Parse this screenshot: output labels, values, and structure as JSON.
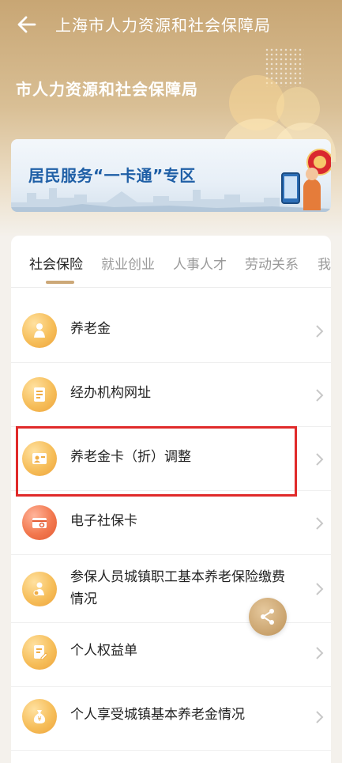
{
  "topbar": {
    "title": "上海市人力资源和社会保障局",
    "back_icon": "arrow-left-icon"
  },
  "hero": {
    "title": "市人力资源和社会保障局"
  },
  "banner": {
    "title": "居民服务“一卡通”专区"
  },
  "tabs": [
    {
      "label": "社会保险",
      "active": true
    },
    {
      "label": "就业创业",
      "active": false
    },
    {
      "label": "人事人才",
      "active": false
    },
    {
      "label": "劳动关系",
      "active": false
    },
    {
      "label": "我",
      "active": false
    }
  ],
  "items": [
    {
      "label": "养老金",
      "icon": "elderly-person-icon",
      "color": "#f6be5a"
    },
    {
      "label": "经办机构网址",
      "icon": "document-list-icon",
      "color": "#f6be5a"
    },
    {
      "label": "养老金卡（折）调整",
      "icon": "id-card-icon",
      "color": "#f6be5a",
      "highlighted": true
    },
    {
      "label": "电子社保卡",
      "icon": "social-security-card-icon",
      "color": "#f2784f"
    },
    {
      "label_line1": "参保人员城镇职工基本养老保险缴费",
      "label_line2": "情况",
      "icon": "person-shield-icon",
      "color": "#f6be5a"
    },
    {
      "label": "个人权益单",
      "icon": "edit-document-icon",
      "color": "#f6be5a"
    },
    {
      "label": "个人享受城镇基本养老金情况",
      "icon": "money-bag-icon",
      "color": "#f6be5a"
    }
  ],
  "share_button": {
    "icon": "share-icon"
  },
  "colors": {
    "accent": "#cca878",
    "highlight_border": "#e02a2a",
    "banner_text": "#1f5fa6"
  }
}
